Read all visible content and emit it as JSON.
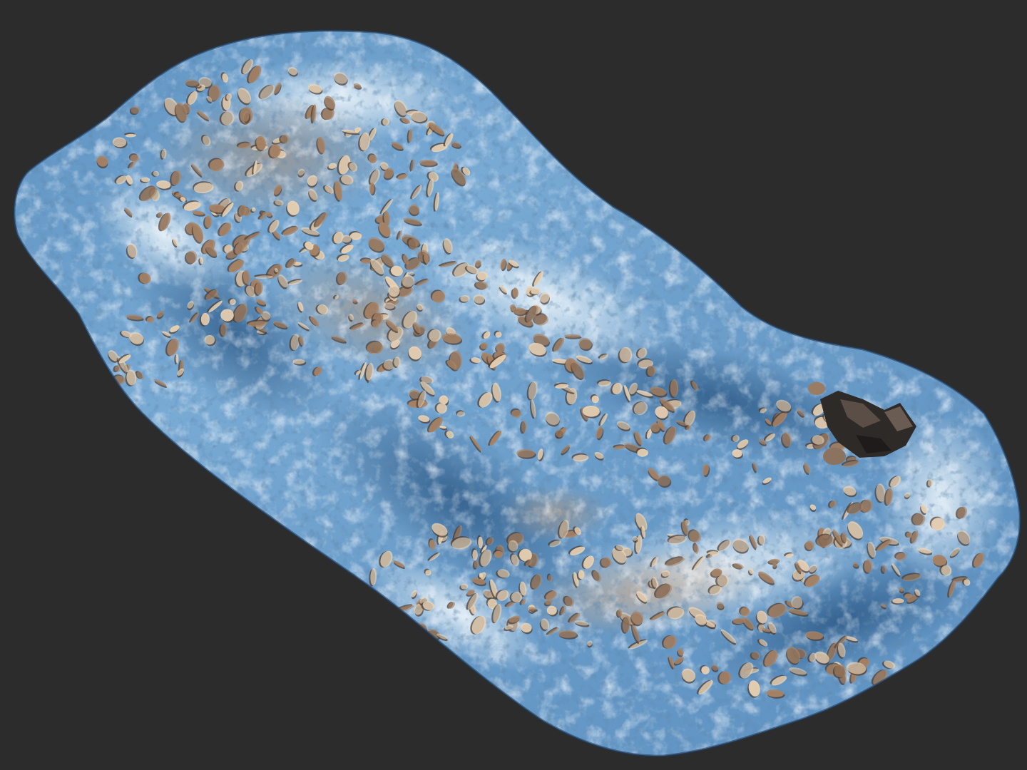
{
  "scene": {
    "kind": "3d-terrain-scan",
    "colors": {
      "background": "#2c2c2c",
      "surface_light": "#dcecf6",
      "surface_mid": "#6fa3cf",
      "surface_dark": "#2f5f8f",
      "rock_light": "#e9d3b6",
      "rock_mid": "#a88466",
      "rock_dark": "#4a3a30",
      "boulder_dark": "#2a2624"
    }
  }
}
